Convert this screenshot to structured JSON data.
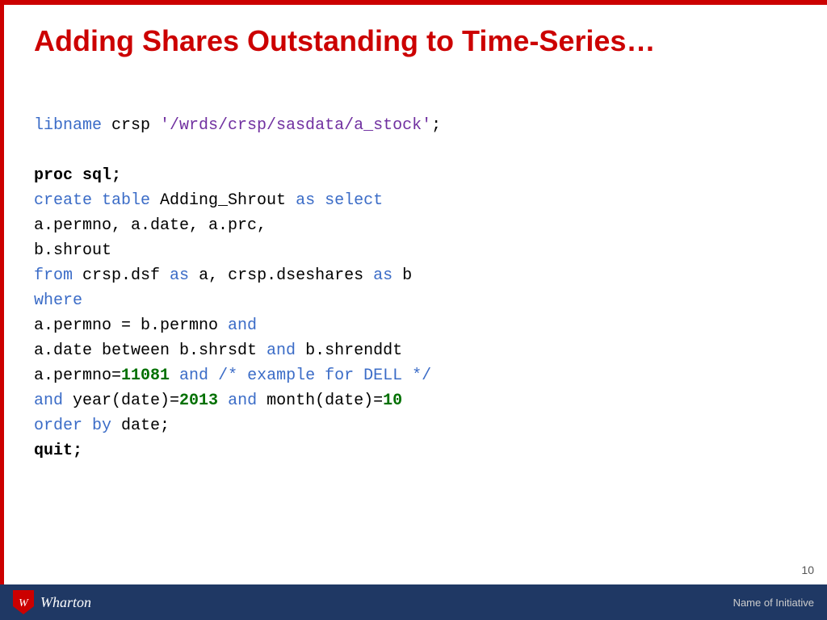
{
  "slide": {
    "title": "Adding Shares Outstanding to Time-Series…",
    "page_number": "10",
    "footer": {
      "logo_text": "Wharton",
      "initiative_label": "Name of Initiative"
    },
    "code": {
      "line1": "libname",
      "line1b": " crsp ",
      "line1c": "'/wrds/crsp/sasdata/a_stock'",
      "line1d": ";",
      "line2": "",
      "line3_kw": "proc sql",
      "line3b": ";",
      "line4_kw1": "create table",
      "line4b": " Adding_Shrout ",
      "line4_kw2": "as select",
      "line5": "a.permno, a.date, a.prc,",
      "line6": "b.shrout",
      "line7_kw": "from",
      "line7b": " crsp.dsf ",
      "line7_kw2": "as",
      "line7c": " a, crsp.dseshares ",
      "line7_kw3": "as",
      "line7d": " b",
      "line8_kw": "where",
      "line9": "a.permno = b.permno ",
      "line9_kw": "and",
      "line10": "a.date between b.shrsdt ",
      "line10_kw": "and",
      "line10b": " b.shrenddt",
      "line11": "a.permno=",
      "line11_num": "11081",
      "line11_kw": " and ",
      "line11_comment": "/* example for DELL */",
      "line12_kw1": "and",
      "line12b": " year(date)=",
      "line12_num": "2013",
      "line12_kw2": " and",
      "line12c": " month(date)=",
      "line12_num2": "10",
      "line13_kw": "order by",
      "line13b": " date;",
      "line14_kw": "quit",
      "line14b": ";"
    }
  }
}
